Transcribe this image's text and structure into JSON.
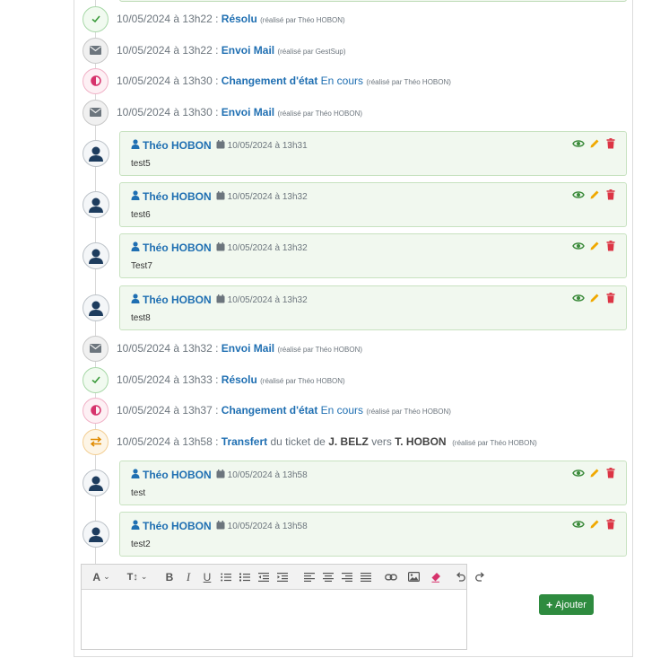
{
  "events": [
    {
      "icon": "check-icon",
      "date": "10/05/2024 à 13h22 :",
      "action": "Résolu",
      "value": "",
      "by": "(réalisé par Théo HOBON)"
    },
    {
      "icon": "envelope-icon",
      "date": "10/05/2024 à 13h22 :",
      "action": "Envoi Mail",
      "value": "",
      "by": "(réalisé par GestSup)"
    },
    {
      "icon": "half-circle-icon",
      "date": "10/05/2024 à 13h30 :",
      "action": "Changement d'état",
      "value": "En cours",
      "by": "(réalisé par Théo HOBON)"
    },
    {
      "icon": "envelope-icon",
      "date": "10/05/2024 à 13h30 :",
      "action": "Envoi Mail",
      "value": "",
      "by": "(réalisé par Théo HOBON)"
    },
    {
      "icon": "envelope-icon",
      "date": "10/05/2024 à 13h32 :",
      "action": "Envoi Mail",
      "value": "",
      "by": "(réalisé par Théo HOBON)"
    },
    {
      "icon": "check-icon",
      "date": "10/05/2024 à 13h33 :",
      "action": "Résolu",
      "value": "",
      "by": "(réalisé par Théo HOBON)"
    },
    {
      "icon": "half-circle-icon",
      "date": "10/05/2024 à 13h37 :",
      "action": "Changement d'état",
      "value": "En cours",
      "by": "(réalisé par Théo HOBON)"
    }
  ],
  "transfer": {
    "date": "10/05/2024 à 13h58 :",
    "action": "Transfert",
    "t1": "du ticket de",
    "from": "J. BELZ",
    "t2": "vers",
    "to": "T. HOBON",
    "by": "(réalisé par Théo HOBON)"
  },
  "comments": [
    {
      "author": "Théo HOBON",
      "date": "10/05/2024 à 13h31",
      "text": "test5"
    },
    {
      "author": "Théo HOBON",
      "date": "10/05/2024 à 13h32",
      "text": "test6"
    },
    {
      "author": "Théo HOBON",
      "date": "10/05/2024 à 13h32",
      "text": "Test7"
    },
    {
      "author": "Théo HOBON",
      "date": "10/05/2024 à 13h32",
      "text": "test8"
    },
    {
      "author": "Théo HOBON",
      "date": "10/05/2024 à 13h58",
      "text": "test"
    },
    {
      "author": "Théo HOBON",
      "date": "10/05/2024 à 13h58",
      "text": "test2"
    }
  ],
  "toolbar": {
    "font_glyph": "A",
    "size_glyph": "T↕",
    "bold": "B",
    "italic": "I",
    "underline": "U"
  },
  "add_button": {
    "label": "Ajouter",
    "icon": "plus-icon"
  },
  "colors": {
    "accent": "#1f6fb2",
    "success": "#2e8b3f",
    "comment_bg": "#f1f8ef",
    "danger": "#dc3545",
    "warning": "#f0a800"
  }
}
